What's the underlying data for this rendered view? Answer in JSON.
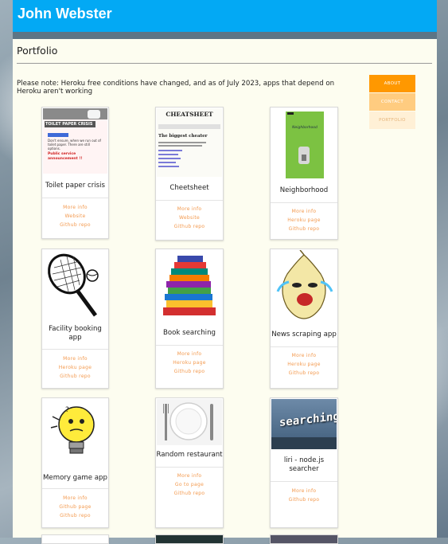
{
  "header": {
    "title": "John Webster"
  },
  "section": {
    "title": "Portfolio"
  },
  "notice": "Please note: Heroku free conditions have changed, and as of July 2023, apps that depend on Heroku aren't working",
  "nav": [
    {
      "label": "ABOUT"
    },
    {
      "label": "CONTACT"
    },
    {
      "label": "PORTFOLIO"
    }
  ],
  "projects": [
    {
      "title": "Toilet paper crisis",
      "icon": "toilet-paper-screenshot",
      "thumb_text": {
        "heading": "TOILET PAPER CRISIS",
        "line1": "Don't ensure, when we run out of toilet paper. There are still options.",
        "line2": "Public service announcement !!"
      },
      "links": [
        "More info",
        "Website",
        "Github repo"
      ]
    },
    {
      "title": "Cheetsheet",
      "icon": "cheatsheet-screenshot",
      "thumb_text": {
        "heading": "CHEATSHEET",
        "subheading": "The biggest cheater"
      },
      "links": [
        "More info",
        "Website",
        "Github repo"
      ]
    },
    {
      "title": "Neighborhood",
      "icon": "neighborhood-app-screenshot",
      "thumb_text": {
        "heading": "Neighborhood"
      },
      "links": [
        "More info",
        "Heroku page",
        "Github repo"
      ]
    },
    {
      "title": "Facility booking app",
      "icon": "tennis-racket-image",
      "links": [
        "More info",
        "Heroku page",
        "Github repo"
      ]
    },
    {
      "title": "Book searching",
      "icon": "book-stack-image",
      "links": [
        "More info",
        "Heroku page",
        "Github repo"
      ]
    },
    {
      "title": "News scraping app",
      "icon": "crying-onion-image",
      "links": [
        "More info",
        "Heroku page",
        "Github repo"
      ]
    },
    {
      "title": "Memory game app",
      "icon": "lightbulb-image",
      "links": [
        "More info",
        "Github page",
        "Github repo"
      ]
    },
    {
      "title": "Random restaurant",
      "icon": "plate-cutlery-image",
      "links": [
        "More info",
        "Go to page",
        "Github repo"
      ]
    },
    {
      "title": "liri - node.js searcher",
      "icon": "search-keyboard-image",
      "thumb_text": {
        "heading": "searching"
      },
      "links": [
        "More info",
        "Github repo"
      ]
    }
  ],
  "colors": {
    "header": "#03a9f4",
    "accent": "#ff9800",
    "link": "#f39a4f",
    "page": "#fdfdf0"
  }
}
